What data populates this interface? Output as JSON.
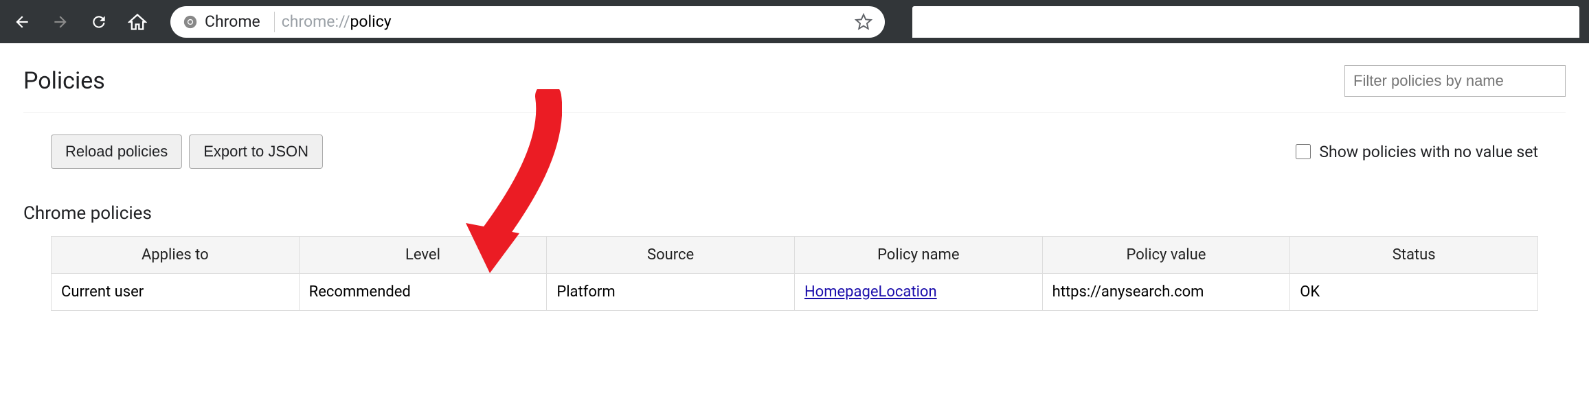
{
  "browser": {
    "omnibox_label": "Chrome",
    "url_faded": "chrome://",
    "url_main": "policy"
  },
  "header": {
    "title": "Policies",
    "filter_placeholder": "Filter policies by name"
  },
  "actions": {
    "reload_label": "Reload policies",
    "export_label": "Export to JSON",
    "checkbox_label": "Show policies with no value set"
  },
  "section": {
    "title": "Chrome policies"
  },
  "table": {
    "headers": {
      "applies_to": "Applies to",
      "level": "Level",
      "source": "Source",
      "policy_name": "Policy name",
      "policy_value": "Policy value",
      "status": "Status"
    },
    "row": {
      "applies_to": "Current user",
      "level": "Recommended",
      "source": "Platform",
      "policy_name": "HomepageLocation",
      "policy_value": "https://anysearch.com",
      "status": "OK"
    }
  }
}
